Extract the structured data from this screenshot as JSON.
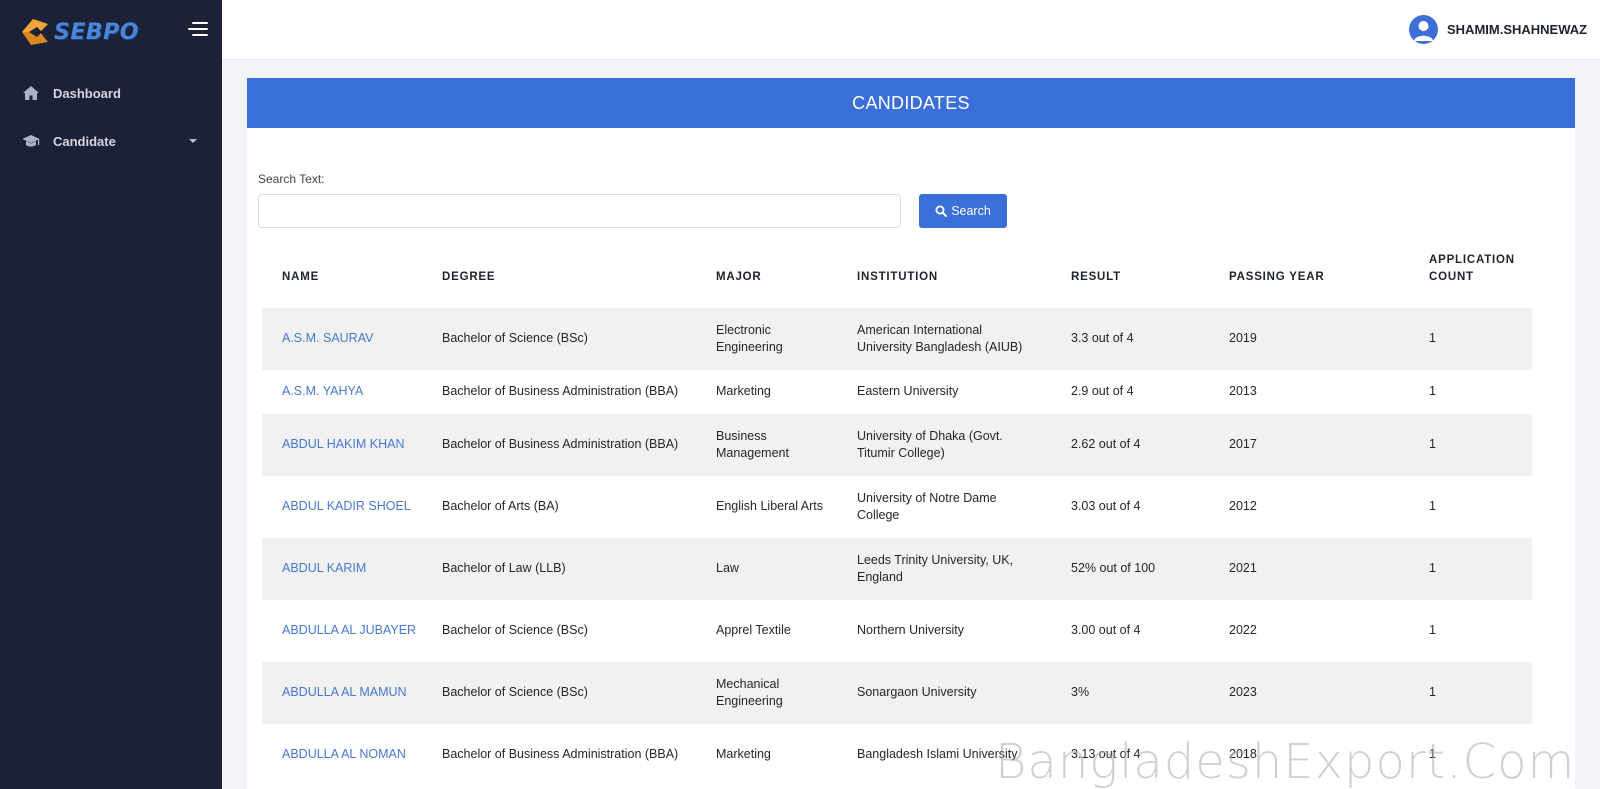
{
  "brand": {
    "logo_text": "SEBPO",
    "accent": "#3a6fda",
    "sidebar_bg": "#1c2138"
  },
  "sidebar": {
    "items": [
      {
        "label": "Dashboard",
        "icon": "home-icon"
      },
      {
        "label": "Candidate",
        "icon": "graduation-cap-icon",
        "has_dropdown": true
      }
    ]
  },
  "topbar": {
    "username": "SHAMIM.SHAHNEWAZ",
    "avatar_icon": "user-avatar-icon"
  },
  "page": {
    "title": "CANDIDATES",
    "search": {
      "label": "Search Text:",
      "value": "",
      "placeholder": "",
      "button_label": "Search"
    }
  },
  "table": {
    "columns": [
      "NAME",
      "DEGREE",
      "MAJOR",
      "INSTITUTION",
      "RESULT",
      "PASSING YEAR",
      "APPLICATION COUNT"
    ],
    "rows": [
      {
        "name": "A.S.M. SAURAV",
        "degree": "Bachelor of Science (BSc)",
        "major": "Electronic Engineering",
        "institution": "American International University Bangladesh (AIUB)",
        "result": "3.3 out of 4",
        "year": "2019",
        "count": "1"
      },
      {
        "name": "A.S.M. YAHYA",
        "degree": "Bachelor of Business Administration (BBA)",
        "major": "Marketing",
        "institution": "Eastern University",
        "result": "2.9 out of 4",
        "year": "2013",
        "count": "1"
      },
      {
        "name": "ABDUL HAKIM KHAN",
        "degree": "Bachelor of Business Administration (BBA)",
        "major": "Business Management",
        "institution": "University of Dhaka (Govt. Titumir College)",
        "result": "2.62 out of 4",
        "year": "2017",
        "count": "1"
      },
      {
        "name": "ABDUL KADIR SHOEL",
        "degree": "Bachelor of Arts (BA)",
        "major": "English Liberal Arts",
        "institution": "University of Notre Dame College",
        "result": "3.03 out of 4",
        "year": "2012",
        "count": "1"
      },
      {
        "name": "ABDUL KARIM",
        "degree": "Bachelor of Law (LLB)",
        "major": "Law",
        "institution": "Leeds Trinity University, UK, England",
        "result": "52% out of 100",
        "year": "2021",
        "count": "1"
      },
      {
        "name": "ABDULLA AL JUBAYER",
        "degree": "Bachelor of Science (BSc)",
        "major": "Apprel Textile",
        "institution": "Northern University",
        "result": "3.00 out of 4",
        "year": "2022",
        "count": "1"
      },
      {
        "name": "ABDULLA AL MAMUN",
        "degree": "Bachelor of Science (BSc)",
        "major": "Mechanical Engineering",
        "institution": "Sonargaon University",
        "result": "3%",
        "year": "2023",
        "count": "1"
      },
      {
        "name": "ABDULLA AL NOMAN",
        "degree": "Bachelor of Business Administration (BBA)",
        "major": "Marketing",
        "institution": "Bangladesh Islami University",
        "result": "3.13 out of 4",
        "year": "2018",
        "count": "1"
      }
    ]
  },
  "watermark": "BangladeshExport.Com"
}
